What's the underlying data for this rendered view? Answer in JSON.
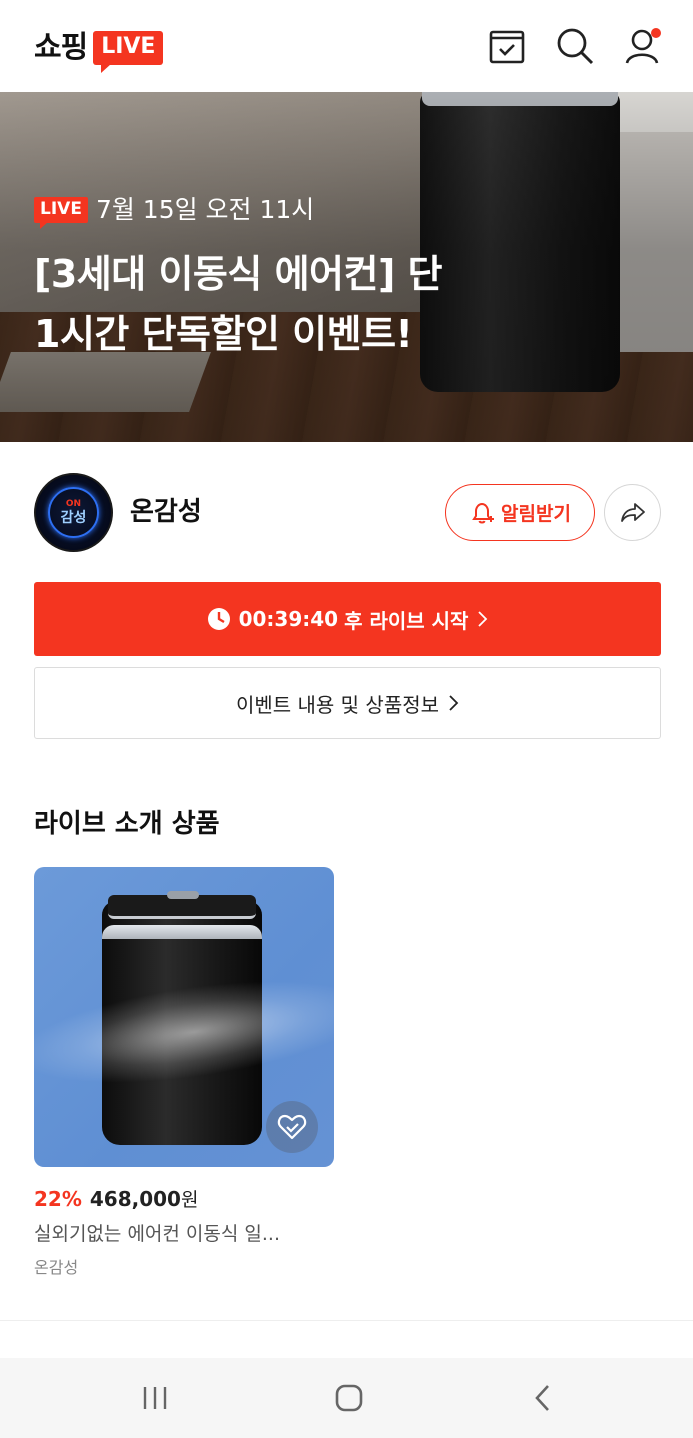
{
  "header": {
    "logo_text": "쇼핑",
    "logo_badge": "LIVE",
    "icons": [
      "calendar-check-icon",
      "search-icon",
      "user-icon"
    ],
    "notification_dot_color": "#f43520"
  },
  "hero": {
    "badge": "LIVE",
    "date": "7월 15일 오전 11시",
    "title_line1": "[3세대 이동식 에어컨] 단",
    "title_line2": "1시간 단독할인 이벤트!"
  },
  "channel": {
    "avatar_top": "ON",
    "avatar_main": "감성",
    "name": "온감성",
    "notify_label": "알림받기",
    "share_icon": "share-arrow-icon"
  },
  "countdown": {
    "time": "00:39:40",
    "suffix": "후 라이브 시작"
  },
  "info_button": {
    "label": "이벤트 내용 및 상품정보"
  },
  "products_section": {
    "title": "라이브 소개 상품",
    "items": [
      {
        "discount": "22%",
        "price": "468,000",
        "currency": "원",
        "name": "실외기없는 에어컨 이동식 일...",
        "seller": "온감성",
        "wish_icon": "heart-check-icon"
      }
    ]
  },
  "navbar": {
    "icons": [
      "recent-apps-icon",
      "home-icon",
      "back-icon"
    ]
  },
  "colors": {
    "accent": "#f43520",
    "text": "#111111",
    "muted": "#888888"
  }
}
